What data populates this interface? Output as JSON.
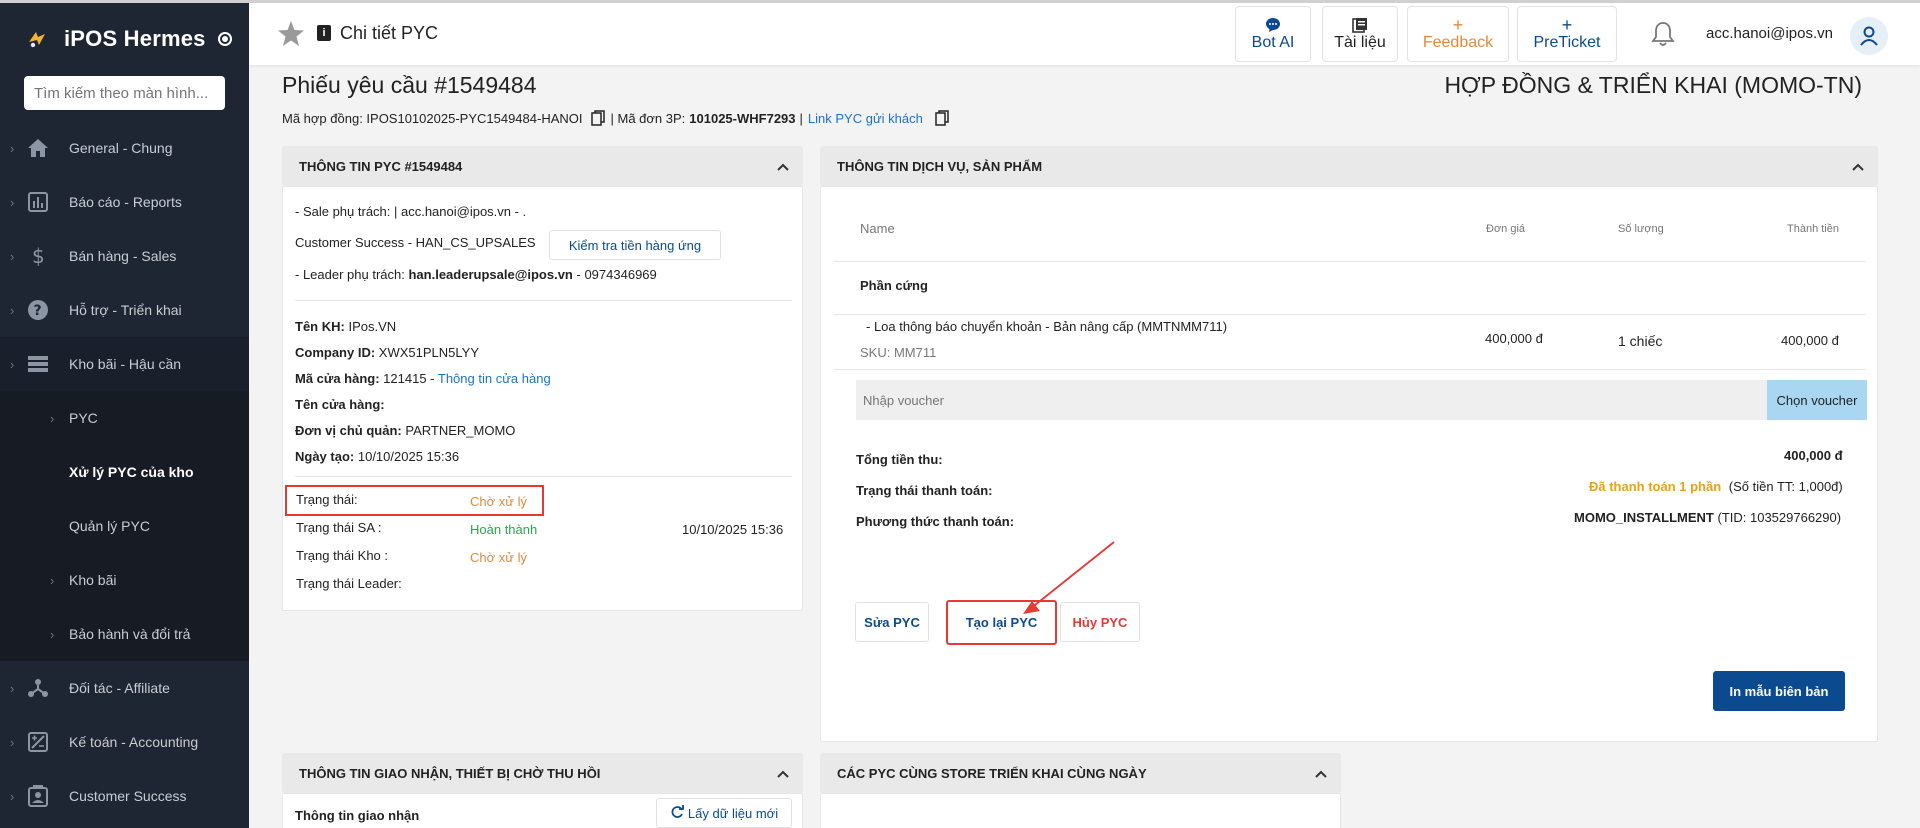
{
  "sidebar": {
    "brand": "iPOS Hermes",
    "search_placeholder": "Tìm kiếm theo màn hình...",
    "items": [
      {
        "label": "General - Chung",
        "icon": "home-icon"
      },
      {
        "label": "Báo cáo - Reports",
        "icon": "chart-icon"
      },
      {
        "label": "Bán hàng - Sales",
        "icon": "dollar-icon"
      },
      {
        "label": "Hỗ trợ - Triển khai",
        "icon": "help-icon"
      },
      {
        "label": "Kho bãi - Hậu cần",
        "icon": "storage-icon"
      }
    ],
    "sub_items": [
      {
        "label": "PYC"
      },
      {
        "label": "Xử lý PYC của kho"
      },
      {
        "label": "Quản lý PYC"
      },
      {
        "label": "Kho bãi"
      },
      {
        "label": "Bảo hành và đổi trả"
      }
    ],
    "items_after": [
      {
        "label": "Đối tác - Affiliate",
        "icon": "affiliate-icon"
      },
      {
        "label": "Kế toán - Accounting",
        "icon": "accounting-icon"
      },
      {
        "label": "Customer Success",
        "icon": "customer-icon"
      }
    ]
  },
  "topbar": {
    "title": "Chi tiết PYC",
    "buttons": {
      "bot": "Bot AI",
      "docs": "Tài liệu",
      "feedback": "Feedback",
      "preticket": "PreTicket"
    },
    "user": "acc.hanoi@ipos.vn"
  },
  "header": {
    "title": "Phiếu yêu cầu #1549484",
    "right_title": "HỢP ĐỒNG & TRIỂN KHAI (MOMO-TN)",
    "contract_label": "Mã hợp đồng: IPOS10102025-PYC1549484-HANOI",
    "order_label": "| Mã đơn 3P:",
    "order_value": "101025-WHF7293",
    "sep": "|",
    "link_label": "Link PYC gửi khách"
  },
  "pyc_info": {
    "head": "THÔNG TIN PYC #1549484",
    "sale": "- Sale phụ trách: | acc.hanoi@ipos.vn - .",
    "cs": "Customer Success - HAN_CS_UPSALES",
    "check_button": "Kiểm tra tiền hàng ứng",
    "leader_label": "- Leader phụ trách:",
    "leader_email": "han.leaderupsale@ipos.vn",
    "leader_phone": "- 0974346969",
    "customer_label": "Tên KH:",
    "customer_value": "IPos.VN",
    "company_label": "Company ID:",
    "company_value": "XWX51PLN5LYY",
    "store_code_label": "Mã cửa hàng:",
    "store_code_value": "121415 -",
    "store_link": "Thông tin cửa hàng",
    "store_name_label": "Tên cửa hàng:",
    "unit_label": "Đơn vị chủ quản:",
    "unit_value": "PARTNER_MOMO",
    "created_label": "Ngày tạo:",
    "created_value": "10/10/2025 15:36",
    "status_label": "Trạng thái:",
    "status_value": "Chờ xử lý",
    "sa_label": "Trạng thái SA :",
    "sa_value": "Hoàn thành",
    "sa_time": "10/10/2025 15:36",
    "wh_label": "Trạng thái Kho :",
    "wh_value": "Chờ xử lý",
    "leader_status_label": "Trạng thái Leader:"
  },
  "service": {
    "head": "THÔNG TIN DỊCH VỤ, SẢN PHẨM",
    "columns": [
      "Name",
      "Đơn giá",
      "Số lượng",
      "Thành tiền"
    ],
    "group": "Phần cứng",
    "item_name": "- Loa thông báo chuyển khoản - Bản nâng cấp (MMTNMM711)",
    "item_sku": "SKU: MM711",
    "item_price": "400,000 đ",
    "item_qty": "1 chiếc",
    "item_total": "400,000 đ",
    "voucher_placeholder": "Nhập voucher",
    "voucher_button": "Chọn voucher",
    "total_label": "Tổng tiền thu:",
    "total_value": "400,000 đ",
    "pay_status_label": "Trạng thái thanh toán:",
    "pay_status_value": "Đã thanh toán 1 phần",
    "pay_status_extra": "(Số tiền TT: 1,000đ)",
    "pay_method_label": "Phương thức thanh toán:",
    "pay_method_value": "MOMO_INSTALLMENT",
    "pay_method_extra": "(TID: 103529766290)",
    "btn_edit": "Sửa PYC",
    "btn_recreate": "Tạo lại PYC",
    "btn_cancel": "Hủy PYC",
    "btn_print": "In mẫu biên bản"
  },
  "delivery": {
    "head": "THÔNG TIN GIAO NHẬN, THIẾT BỊ CHỜ THU HỒI",
    "sub_label": "Thông tin giao nhận",
    "refresh": "Lấy dữ liệu mới"
  },
  "same_store": {
    "head": "CÁC PYC CÙNG STORE TRIỂN KHAI CÙNG NGÀY"
  },
  "colors": {
    "sidebar_bg": "#1f2633",
    "primary": "#0b4a8f",
    "link": "#1a73c8",
    "orange": "#e5883a",
    "green": "#2ea44f",
    "red": "#e53935"
  }
}
